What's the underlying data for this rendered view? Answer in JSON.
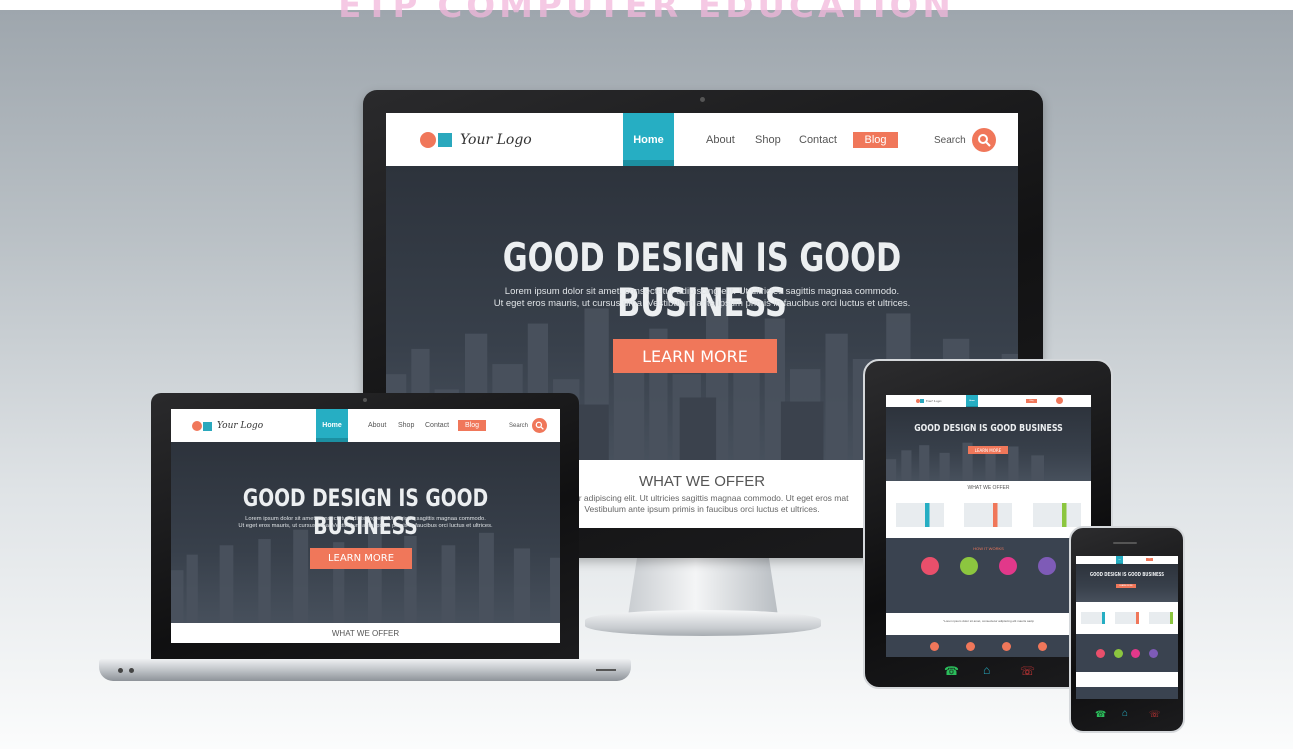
{
  "watermark": "ETP COMPUTER EDUCATION",
  "site": {
    "logo_text": "Your Logo",
    "nav": {
      "home": "Home",
      "about": "About",
      "shop": "Shop",
      "contact": "Contact",
      "blog": "Blog",
      "search": "Search"
    },
    "hero": {
      "headline": "GOOD DESIGN IS GOOD BUSINESS",
      "body_line1": "Lorem ipsum dolor sit amet, consectetur adipiscing elit. Ut ultricies sagittis magnaa commodo.",
      "body_line2": "Ut eget eros mauris, ut cursus urna. Vestibulum ante ipsum primis in faucibus orci luctus et ultrices.",
      "cta": "LEARN MORE"
    },
    "offer": {
      "title": "WHAT WE OFFER",
      "line1": "ectetur adipiscing elit. Ut ultricies sagittis magnaa commodo. Ut eget eros mat",
      "line2": "Vestibulum ante ipsum primis in faucibus orci luctus et ultrices."
    },
    "tablet": {
      "how_title": "HOW IT WORKS",
      "quote": "\"Lorem ipsum dolor sit amet, consectetur adipiscing elit mauris sacip"
    }
  },
  "colors": {
    "accent": "#f0775a",
    "brand": "#26aec3",
    "dark": "#2e343d",
    "nav_text": "#555555"
  },
  "devices": [
    "desktop-monitor",
    "laptop",
    "tablet",
    "smartphone"
  ]
}
